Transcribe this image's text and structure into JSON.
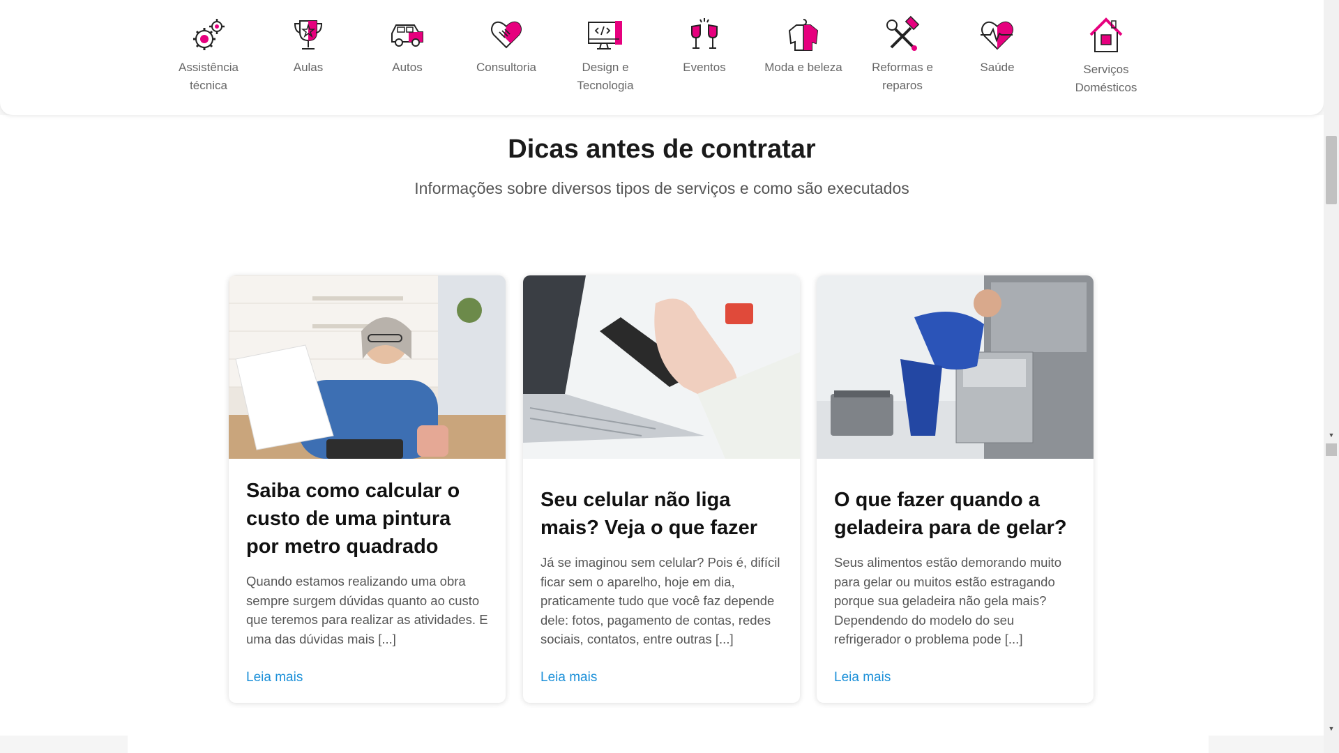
{
  "brand_color": "#e6007e",
  "categories": [
    {
      "label": "Assistência técnica",
      "icon": "gears-icon"
    },
    {
      "label": "Aulas",
      "icon": "trophy-icon"
    },
    {
      "label": "Autos",
      "icon": "car-icon"
    },
    {
      "label": "Consultoria",
      "icon": "handshake-heart-icon"
    },
    {
      "label": "Design e Tecnologia",
      "icon": "monitor-code-icon"
    },
    {
      "label": "Eventos",
      "icon": "toast-glasses-icon"
    },
    {
      "label": "Moda e beleza",
      "icon": "shirt-hanger-icon"
    },
    {
      "label": "Reformas e reparos",
      "icon": "hammer-wrench-icon"
    },
    {
      "label": "Saúde",
      "icon": "heart-pulse-icon"
    },
    {
      "label": "Serviços Domésticos",
      "icon": "house-icon"
    }
  ],
  "section": {
    "title": "Dicas antes de contratar",
    "subtitle": "Informações sobre diversos tipos de serviços e como são executados"
  },
  "cards": [
    {
      "image": "woman-calculating-bills-image",
      "title": "Saiba como calcular o custo de uma pintura por metro quadrado",
      "text": "Quando estamos realizando uma obra sempre surgem dúvidas quanto ao custo que teremos para realizar as atividades. E uma das dúvidas mais [...]",
      "link": "Leia mais"
    },
    {
      "image": "hand-holding-phone-laptop-image",
      "title": "Seu celular não liga mais? Veja o que fazer",
      "text": "Já se imaginou sem celular? Pois é, difícil ficar sem o aparelho, hoje em dia, praticamente tudo que você faz depende dele: fotos, pagamento de contas, redes sociais, contatos, entre outras [...]",
      "link": "Leia mais"
    },
    {
      "image": "technician-repairing-fridge-image",
      "title": "O que fazer quando a geladeira para de gelar?",
      "text": "Seus alimentos estão demorando muito para gelar ou muitos estão estragando porque sua geladeira não gela mais? Dependendo do modelo do seu refrigerador o problema pode [...]",
      "link": "Leia mais"
    }
  ]
}
